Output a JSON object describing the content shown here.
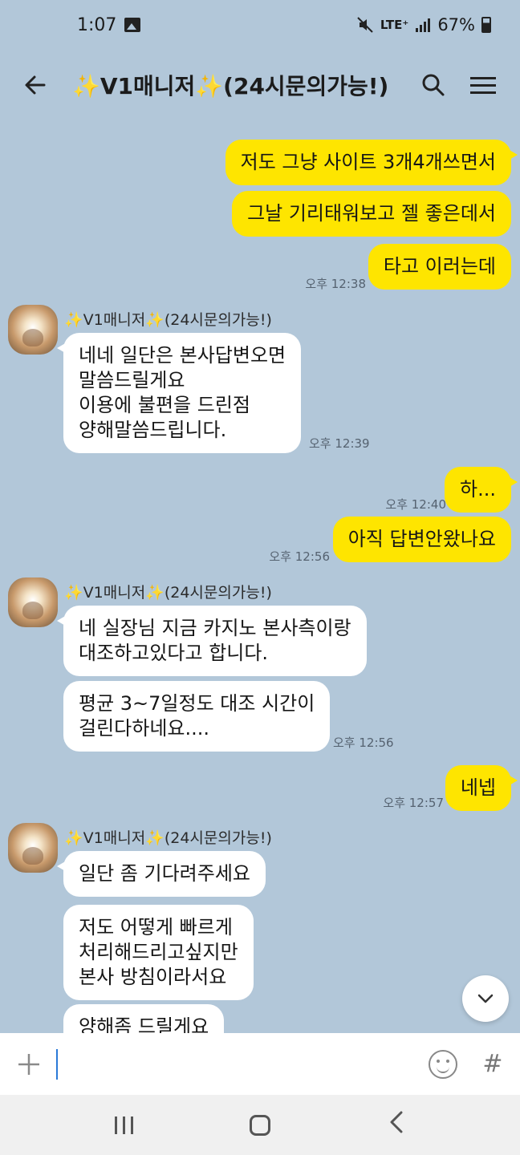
{
  "status": {
    "time": "1:07",
    "network": "LTE⁺",
    "battery": "67%"
  },
  "header": {
    "title": "✨V1매니저✨(24시문의가능!)"
  },
  "chat": {
    "sender_name": "✨V1매니저✨(24시문의가능!)",
    "messages": [
      {
        "from": "me",
        "text": "저도 그냥 사이트 3개4개쓰면서"
      },
      {
        "from": "me",
        "text": "그날 기리태워보고 젤 좋은데서"
      },
      {
        "from": "me",
        "text": "타고 이러는데",
        "time": "오후 12:38"
      },
      {
        "from": "them",
        "text": "네네 일단은 본사답변오면\n말씀드릴게요\n이용에 불편을 드린점\n양해말씀드립니다.",
        "time": "오후 12:39"
      },
      {
        "from": "me",
        "text": "하...",
        "time": "오후 12:40"
      },
      {
        "from": "me",
        "text": "아직 답변안왔나요",
        "time": "오후 12:56"
      },
      {
        "from": "them",
        "text": "네 실장님 지금 카지노 본사측이랑\n대조하고있다고 합니다."
      },
      {
        "from": "them",
        "text": "평균 3~7일정도 대조 시간이\n걸린다하네요....",
        "time": "오후 12:56"
      },
      {
        "from": "me",
        "text": "네넵",
        "time": "오후 12:57"
      },
      {
        "from": "them",
        "text": "일단 좀 기다려주세요"
      },
      {
        "from": "them",
        "text": "저도 어떻게 빠르게\n처리해드리고싶지만\n본사 방침이라서요"
      },
      {
        "from": "them",
        "text": "양해좀 드릴게요"
      }
    ]
  },
  "input": {
    "value": ""
  },
  "icons": {
    "back": "arrow-left-icon",
    "search": "search-icon",
    "menu": "menu-icon",
    "add": "plus-icon",
    "emoji": "emoji-icon",
    "hashtag": "hash-icon",
    "scroll": "chevron-down-icon"
  },
  "colors": {
    "background": "#b2c7d9",
    "my_bubble": "#fee500",
    "their_bubble": "#ffffff"
  }
}
